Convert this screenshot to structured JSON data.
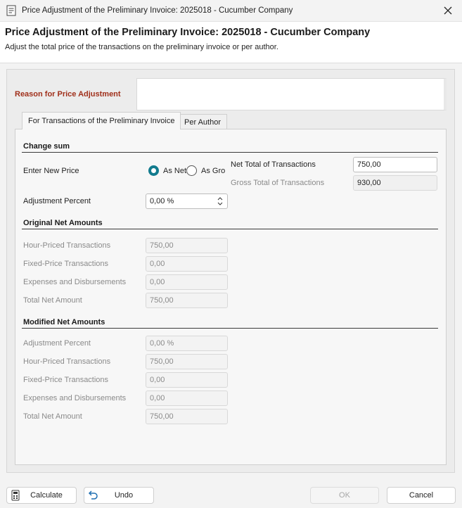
{
  "window": {
    "title": "Price Adjustment of the Preliminary Invoice: 2025018 - Cucumber Company",
    "close_icon": "close-icon",
    "app_icon": "invoice-document-icon"
  },
  "header": {
    "title": "Price Adjustment of the Preliminary Invoice: 2025018 - Cucumber Company",
    "subtitle": "Adjust the total price of the transactions on the preliminary invoice or per author."
  },
  "reason": {
    "label": "Reason for Price Adjustment",
    "value": ""
  },
  "tabs": [
    {
      "label": "For Transactions of the Preliminary Invoice",
      "active": true
    },
    {
      "label": "Per Author",
      "active": false
    }
  ],
  "change_sum": {
    "heading": "Change sum",
    "enter_new_price_label": "Enter New Price",
    "radio_net_label": "As Net",
    "radio_gross_label": "As Gro",
    "selected_radio": "As Net",
    "net_total_label": "Net Total of Transactions",
    "net_total_value": "750,00",
    "gross_total_label": "Gross Total of Transactions",
    "gross_total_value": "930,00",
    "adjustment_percent_label": "Adjustment Percent",
    "adjustment_percent_value": "0,00 %"
  },
  "original_net": {
    "heading": "Original Net Amounts",
    "rows": [
      {
        "label": "Hour-Priced Transactions",
        "value": "750,00"
      },
      {
        "label": "Fixed-Price Transactions",
        "value": "0,00"
      },
      {
        "label": "Expenses and Disbursements",
        "value": "0,00"
      },
      {
        "label": "Total Net Amount",
        "value": "750,00"
      }
    ]
  },
  "modified_net": {
    "heading": "Modified Net Amounts",
    "rows": [
      {
        "label": "Adjustment Percent",
        "value": "0,00 %"
      },
      {
        "label": "Hour-Priced Transactions",
        "value": "750,00"
      },
      {
        "label": "Fixed-Price Transactions",
        "value": "0,00"
      },
      {
        "label": "Expenses and Disbursements",
        "value": "0,00"
      },
      {
        "label": "Total Net Amount",
        "value": "750,00"
      }
    ]
  },
  "footer": {
    "calculate_label": "Calculate",
    "calculate_icon": "calculator-icon",
    "undo_label": "Undo",
    "undo_icon": "undo-icon",
    "ok_label": "OK",
    "cancel_label": "Cancel"
  },
  "colors": {
    "accent_radio": "#127b8e",
    "reason_label": "#a0301b"
  }
}
